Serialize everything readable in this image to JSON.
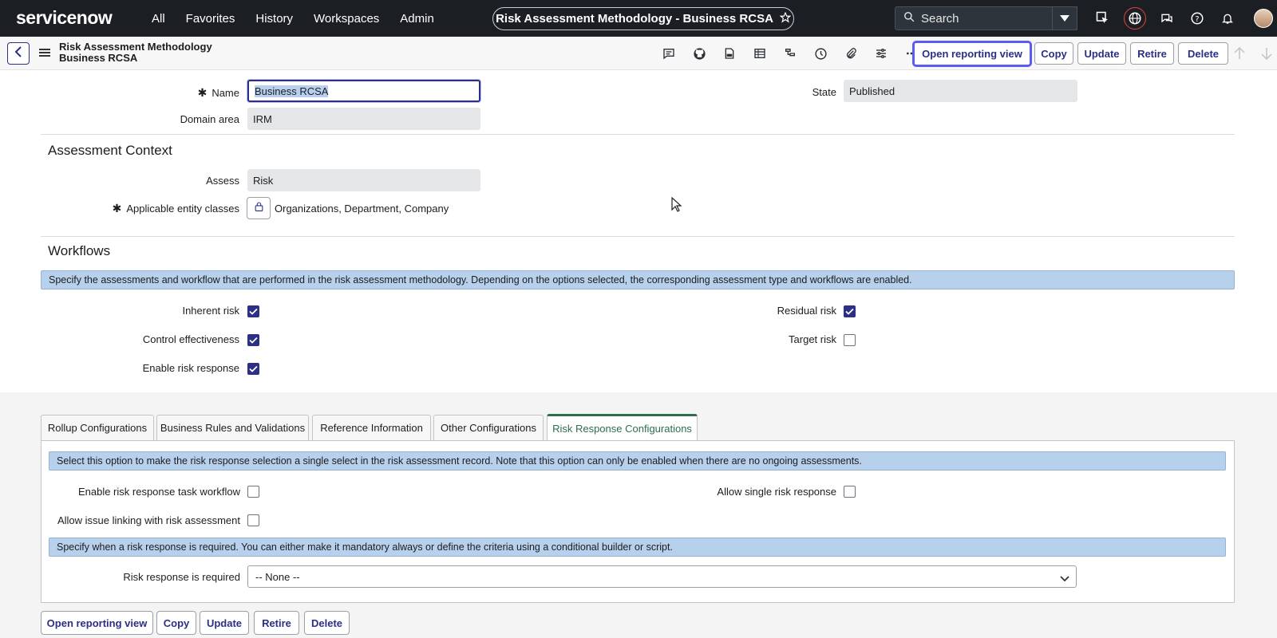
{
  "nav": {
    "logo": "servicenow",
    "links": [
      "All",
      "Favorites",
      "History",
      "Workspaces",
      "Admin"
    ],
    "record_title": "Risk Assessment Methodology - Business RCSA",
    "search_placeholder": "Search"
  },
  "formbar": {
    "title_line1": "Risk Assessment Methodology",
    "title_line2": "Business RCSA",
    "buttons": {
      "open_reporting_view": "Open reporting view",
      "copy": "Copy",
      "update": "Update",
      "retire": "Retire",
      "delete": "Delete"
    }
  },
  "form": {
    "name_label": "Name",
    "name_value": "Business RCSA",
    "domain_label": "Domain area",
    "domain_value": "IRM",
    "state_label": "State",
    "state_value": "Published",
    "context_title": "Assessment Context",
    "assess_label": "Assess",
    "assess_value": "Risk",
    "entity_label": "Applicable entity classes",
    "entity_value": "Organizations, Department, Company",
    "workflows_title": "Workflows",
    "workflows_info": "Specify the assessments and workflow that are performed in the risk assessment methodology. Depending on the options selected, the corresponding assessment type and workflows are enabled.",
    "checks": {
      "inherent_risk": {
        "label": "Inherent risk",
        "checked": true
      },
      "control_effectiveness": {
        "label": "Control effectiveness",
        "checked": true
      },
      "enable_risk_response": {
        "label": "Enable risk response",
        "checked": true
      },
      "residual_risk": {
        "label": "Residual risk",
        "checked": true
      },
      "target_risk": {
        "label": "Target risk",
        "checked": false
      }
    }
  },
  "tabs": {
    "items": [
      "Rollup Configurations",
      "Business Rules and Validations",
      "Reference Information",
      "Other Configurations",
      "Risk Response Configurations"
    ],
    "active": "Risk Response Configurations",
    "info1": "Select this option to make the risk response selection a single select in the risk assessment record. Note that this option can only be enabled when there are no ongoing assessments.",
    "enable_task_workflow": "Enable risk response task workflow",
    "allow_single": "Allow single risk response",
    "allow_issue_linking": "Allow issue linking with risk assessment",
    "info2": "Specify when a risk response is required. You can either make it mandatory always or define the criteria using a conditional builder or script.",
    "required_label": "Risk response is required",
    "required_value": "-- None --"
  },
  "colors": {
    "accent": "#2b2f86",
    "nav_bg": "#1b1f24",
    "info_bg": "#b7d0ec",
    "active_tab": "#2e6e4e"
  }
}
